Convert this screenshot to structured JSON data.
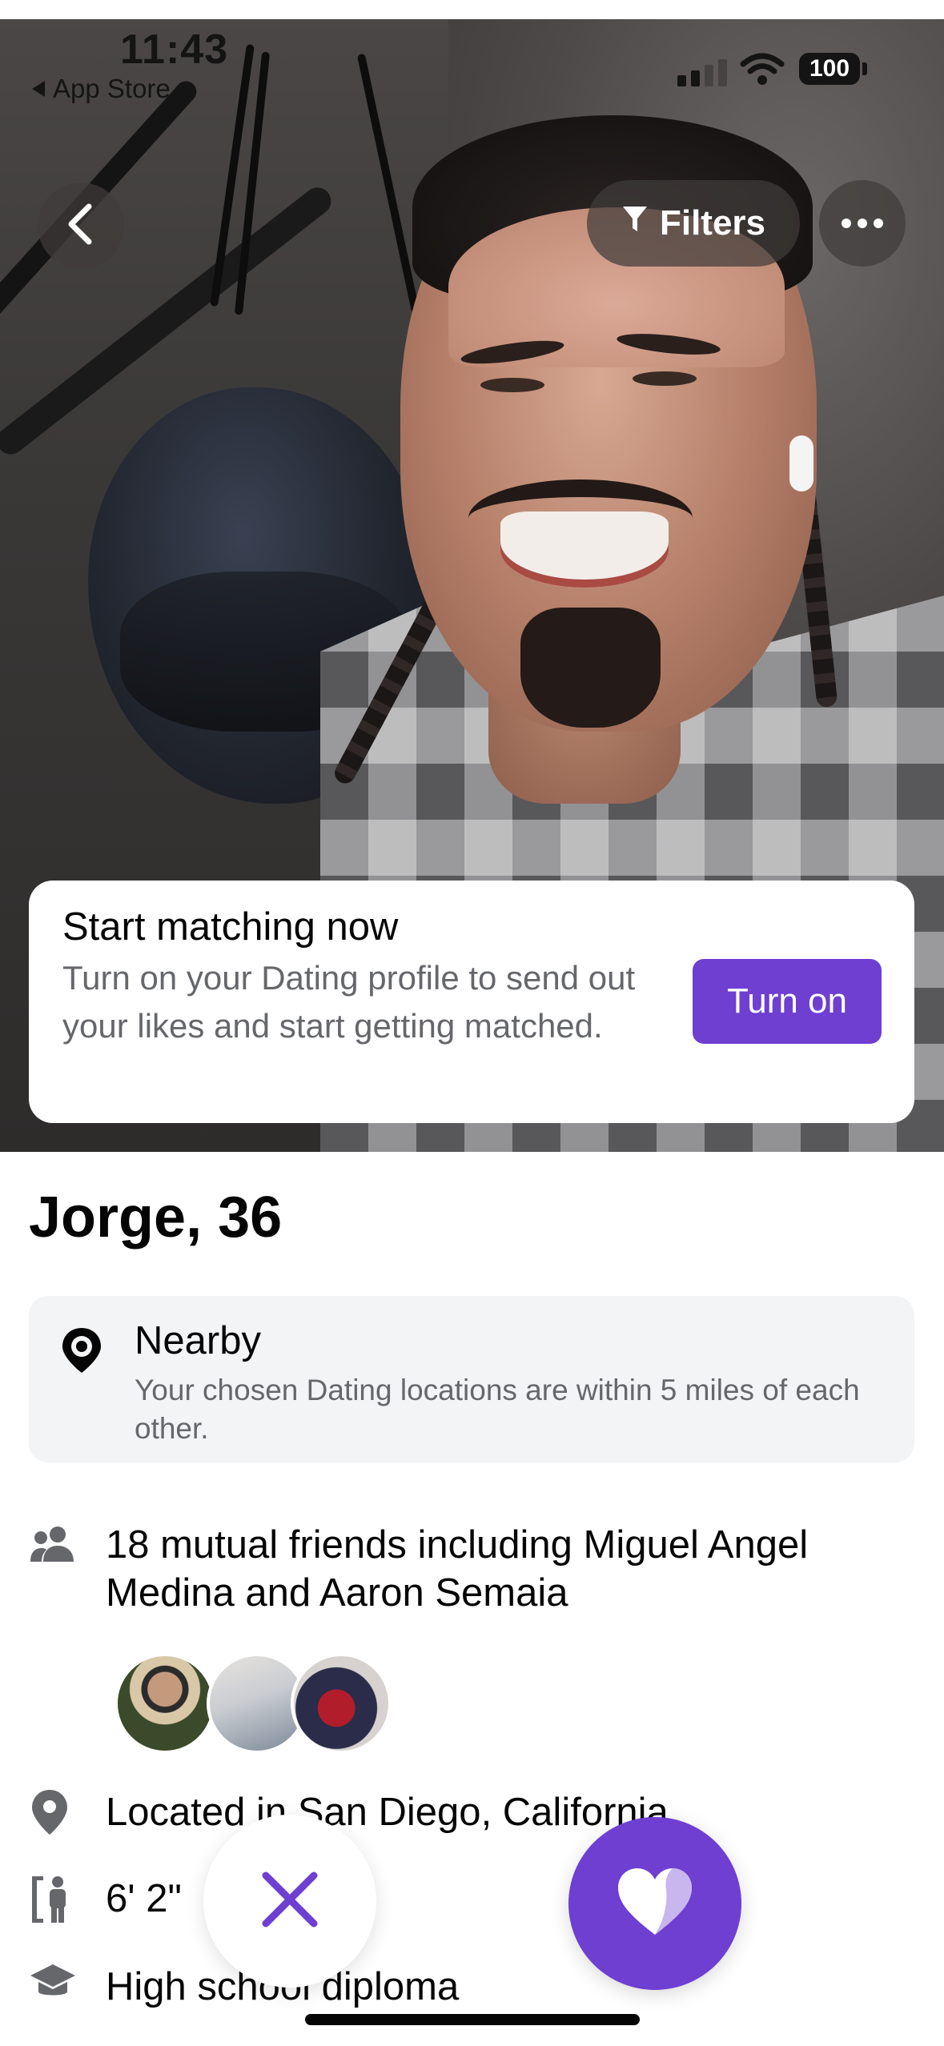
{
  "status_bar": {
    "time": "11:43",
    "back_label": "App Store",
    "battery": "100"
  },
  "photo": {
    "filters_label": "Filters",
    "icons": [
      "back-chevron-icon",
      "filter-icon",
      "more-icon"
    ]
  },
  "prompt_card": {
    "title": "Start matching now",
    "body": "Turn on your Dating profile to send out your likes and start getting matched.",
    "button_label": "Turn on"
  },
  "profile": {
    "name_age": "Jorge, 36",
    "nearby": {
      "title": "Nearby",
      "subtitle": "Your chosen Dating locations are within 5 miles of each other."
    },
    "mutual_friends": {
      "line1": "18 mutual friends including Miguel Angel",
      "line2": "Medina and Aaron Semaia"
    },
    "location": "Located in San Diego, California",
    "height": "6' 2\"",
    "education": "High school diploma"
  },
  "colors": {
    "accent": "#6e3fd1",
    "secondary_text": "#65676b",
    "card_bg": "#f3f4f6"
  }
}
